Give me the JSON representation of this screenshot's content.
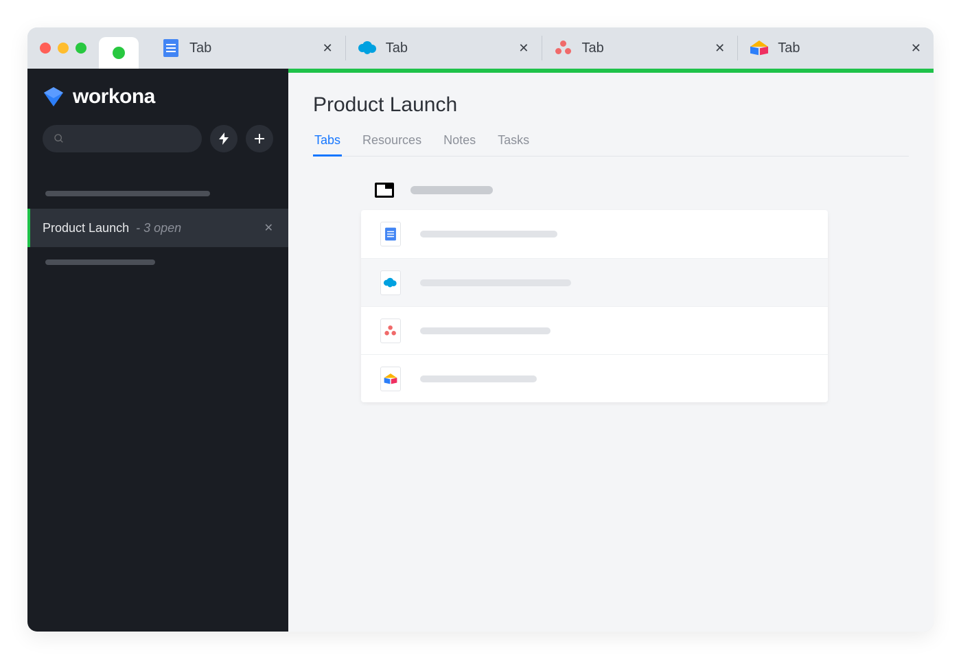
{
  "chrome": {
    "tabs": [
      {
        "label": "Tab",
        "icon": "docs-icon"
      },
      {
        "label": "Tab",
        "icon": "salesforce-icon"
      },
      {
        "label": "Tab",
        "icon": "asana-icon"
      },
      {
        "label": "Tab",
        "icon": "airtable-icon"
      }
    ]
  },
  "sidebar": {
    "brand": "workona",
    "workspace": {
      "title": "Product Launch",
      "meta": "- 3 open"
    }
  },
  "main": {
    "title": "Product Launch",
    "tabs": [
      {
        "label": "Tabs",
        "active": true
      },
      {
        "label": "Resources",
        "active": false
      },
      {
        "label": "Notes",
        "active": false
      },
      {
        "label": "Tasks",
        "active": false
      }
    ],
    "rows": [
      {
        "icon": "docs-icon"
      },
      {
        "icon": "salesforce-icon"
      },
      {
        "icon": "asana-icon"
      },
      {
        "icon": "airtable-icon"
      }
    ]
  },
  "colors": {
    "accent_green": "#1fc24a",
    "accent_blue": "#1677ff",
    "sidebar_bg": "#1a1d23"
  }
}
